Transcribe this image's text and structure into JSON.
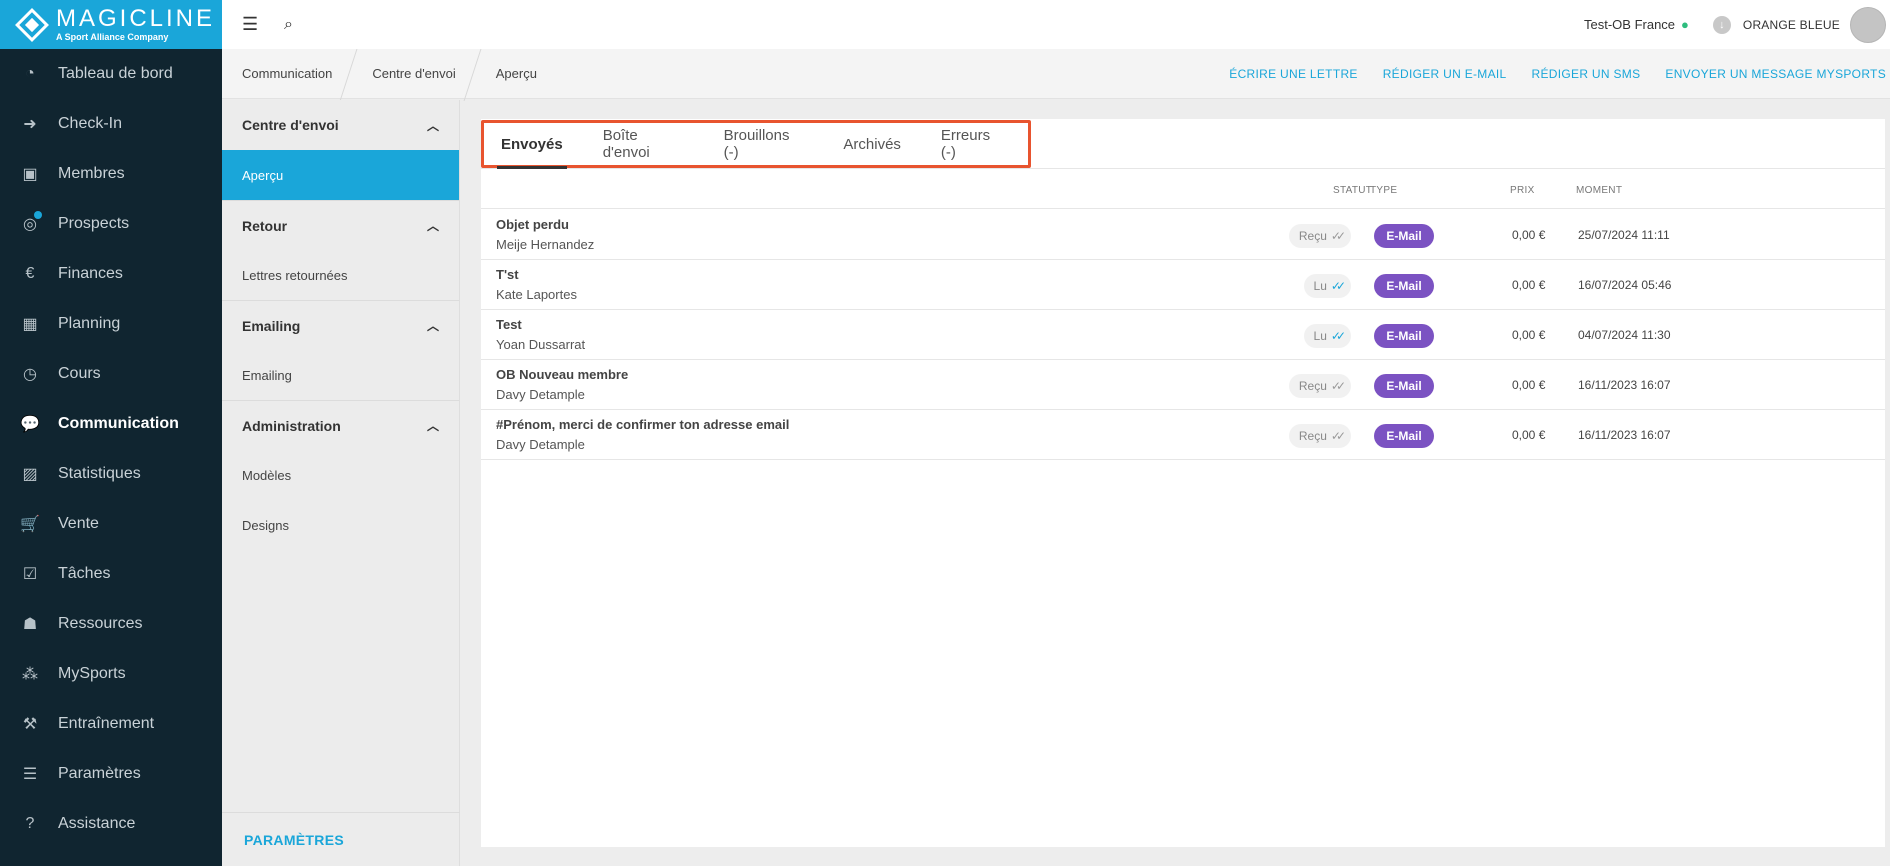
{
  "brand": {
    "name": "MAGICLINE",
    "tagline": "A Sport Alliance Company"
  },
  "nav": [
    {
      "label": "Tableau de bord",
      "icon": "dashboard-icon",
      "glyph": "◔"
    },
    {
      "label": "Check-In",
      "icon": "check-in-icon",
      "glyph": "➜"
    },
    {
      "label": "Membres",
      "icon": "members-icon",
      "glyph": "▣"
    },
    {
      "label": "Prospects",
      "icon": "prospects-icon",
      "glyph": "◎"
    },
    {
      "label": "Finances",
      "icon": "finances-icon",
      "glyph": "€"
    },
    {
      "label": "Planning",
      "icon": "calendar-icon",
      "glyph": "▦"
    },
    {
      "label": "Cours",
      "icon": "stopwatch-icon",
      "glyph": "◷"
    },
    {
      "label": "Communication",
      "icon": "chat-icon",
      "glyph": "💬"
    },
    {
      "label": "Statistiques",
      "icon": "chart-icon",
      "glyph": "▨"
    },
    {
      "label": "Vente",
      "icon": "cart-icon",
      "glyph": "🛒"
    },
    {
      "label": "Tâches",
      "icon": "task-check-icon",
      "glyph": "☑"
    },
    {
      "label": "Ressources",
      "icon": "resources-icon",
      "glyph": "☗"
    },
    {
      "label": "MySports",
      "icon": "mysports-icon",
      "glyph": "⁂"
    },
    {
      "label": "Entraînement",
      "icon": "dumbbell-icon",
      "glyph": "⚒"
    },
    {
      "label": "Paramètres",
      "icon": "sliders-icon",
      "glyph": "☰"
    },
    {
      "label": "Assistance",
      "icon": "help-icon",
      "glyph": "?"
    }
  ],
  "topbar": {
    "studio": "Test-OB France",
    "org": "ORANGE BLEUE"
  },
  "breadcrumb": [
    "Communication",
    "Centre d'envoi",
    "Aperçu"
  ],
  "actions": [
    "ÉCRIRE UNE LETTRE",
    "RÉDIGER UN E-MAIL",
    "RÉDIGER UN SMS",
    "ENVOYER UN MESSAGE MYSPORTS"
  ],
  "subnav": {
    "groups": [
      {
        "label": "Centre d'envoi",
        "items": [
          "Aperçu"
        ]
      },
      {
        "label": "Retour",
        "items": [
          "Lettres retournées"
        ]
      },
      {
        "label": "Emailing",
        "items": [
          "Emailing"
        ]
      },
      {
        "label": "Administration",
        "items": [
          "Modèles",
          "Designs"
        ]
      }
    ],
    "footer": "PARAMÈTRES"
  },
  "tabs": [
    "Envoyés",
    "Boîte d'envoi",
    "Brouillons (-)",
    "Archivés",
    "Erreurs (-)"
  ],
  "table": {
    "headers": {
      "status": "STATUT",
      "type": "TYPE",
      "price": "PRIX",
      "moment": "MOMENT"
    },
    "rows": [
      {
        "subject": "Objet perdu",
        "recipient": "Meije Hernandez",
        "status": "Reçu",
        "type": "E-Mail",
        "price": "0,00 €",
        "moment": "25/07/2024 11:11"
      },
      {
        "subject": "T'st",
        "recipient": "Kate Laportes",
        "status": "Lu",
        "type": "E-Mail",
        "price": "0,00 €",
        "moment": "16/07/2024 05:46"
      },
      {
        "subject": "Test",
        "recipient": "Yoan Dussarrat",
        "status": "Lu",
        "type": "E-Mail",
        "price": "0,00 €",
        "moment": "04/07/2024 11:30"
      },
      {
        "subject": "OB Nouveau membre",
        "recipient": "Davy Detample",
        "status": "Reçu",
        "type": "E-Mail",
        "price": "0,00 €",
        "moment": "16/11/2023 16:07"
      },
      {
        "subject": "#Prénom, merci de confirmer ton adresse email",
        "recipient": "Davy Detample",
        "status": "Reçu",
        "type": "E-Mail",
        "price": "0,00 €",
        "moment": "16/11/2023 16:07"
      }
    ]
  },
  "colors": {
    "accent": "#1aa6d9",
    "sidebar": "#102530",
    "type_badge": "#7b52c2",
    "highlight_frame": "#e8542f"
  }
}
